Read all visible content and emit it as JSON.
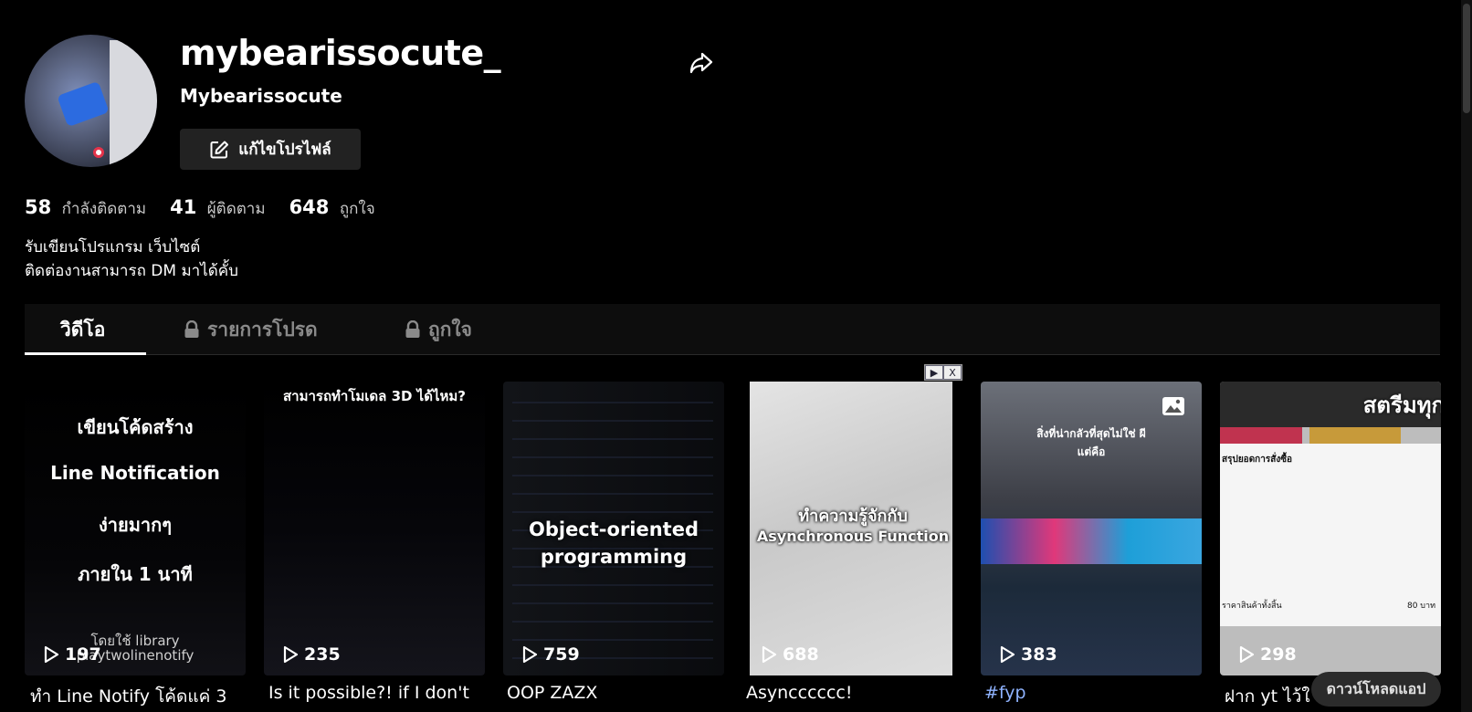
{
  "profile": {
    "username": "mybearissocute_",
    "nickname": "Mybearissocute",
    "edit_label": "แก้ไขโปรไฟล์",
    "avatar_icon": "avatar-image",
    "share_icon": "share-icon",
    "stats": [
      {
        "num": "58",
        "label": "กำลังติดตาม"
      },
      {
        "num": "41",
        "label": "ผู้ติดตาม"
      },
      {
        "num": "648",
        "label": "ถูกใจ"
      }
    ],
    "bio": [
      "รับเขียนโปรแกรม เว็บไซต์",
      "ติดต่องานสามารถ DM มาได้คั้บ"
    ]
  },
  "tabs": [
    {
      "label": "วิดีโอ",
      "locked": false,
      "active": true
    },
    {
      "label": "รายการโปรด",
      "locked": true,
      "active": false
    },
    {
      "label": "ถูกใจ",
      "locked": true,
      "active": false
    }
  ],
  "videos": [
    {
      "views": "197",
      "caption": "ทำ Line Notify โค้ดแค่ 3",
      "overlay": [
        "เขียนโค้ดสร้าง",
        "Line Notification",
        "ง่ายมากๆ",
        "ภายใน 1 นาที"
      ],
      "overlay_small": [
        "โดยใช้ library",
        "playtwolinenotify"
      ]
    },
    {
      "views": "235",
      "caption": "Is it possible?! if I don't",
      "overlay": [
        "สามารถทำโมเดล 3D ได้ไหม?"
      ]
    },
    {
      "views": "759",
      "caption": "OOP ZAZX",
      "overlay": [
        "Object-oriented",
        "programming"
      ]
    },
    {
      "views": "688",
      "caption": "Asyncccccc!",
      "overlay": [
        "ทำความรู้จักกับ",
        "Asynchronous Function"
      ]
    },
    {
      "views": "383",
      "caption": "#fyp",
      "overlay": [
        "สิ่งที่น่ากลัวที่สุดไม่ใช่ ผี",
        "แต่คือ"
      ]
    },
    {
      "views": "298",
      "caption": "ฝาก yt ไว้ใ",
      "overlay": [
        "สตรีมทุก"
      ],
      "receipt_title": "สรุปยอดการสั่งซื้อ",
      "receipt_total_label": "ราคาสินค้าทั้งสิ้น",
      "receipt_total": "80 บาท"
    }
  ],
  "ad": {
    "play": "▶",
    "close": "X"
  },
  "download_label": "ดาวน์โหลดแอป",
  "colors": {
    "background": "#000000",
    "hashtag": "#8fb3ff",
    "tab_bar": "#0d0d0d"
  }
}
